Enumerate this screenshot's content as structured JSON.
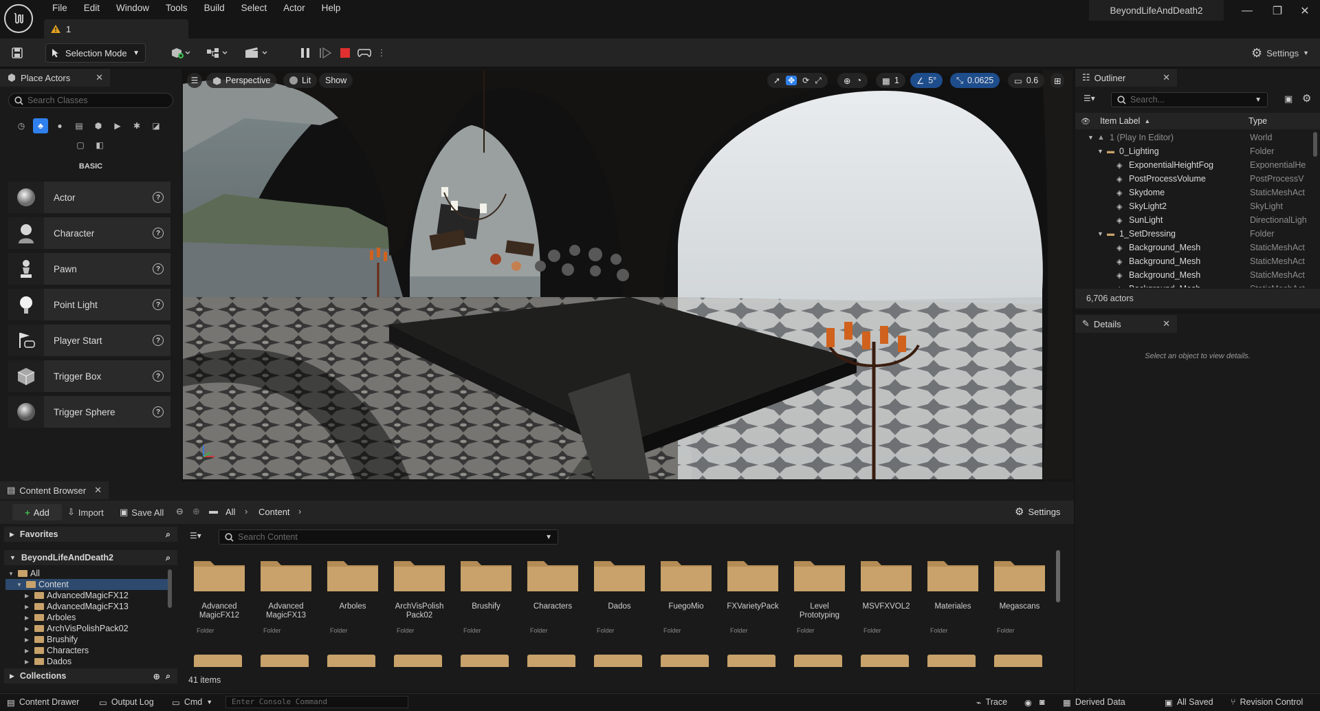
{
  "app": {
    "project_name": "BeyondLifeAndDeath2",
    "doc_tab_label": "1",
    "menu": [
      "File",
      "Edit",
      "Window",
      "Tools",
      "Build",
      "Select",
      "Actor",
      "Help"
    ]
  },
  "toolbar": {
    "selection_mode": "Selection Mode",
    "settings": "Settings"
  },
  "place_actors": {
    "title": "Place Actors",
    "search_placeholder": "Search Classes",
    "category": "BASIC",
    "items": [
      {
        "label": "Actor",
        "icon": "sphere-icon"
      },
      {
        "label": "Character",
        "icon": "character-icon"
      },
      {
        "label": "Pawn",
        "icon": "pawn-icon"
      },
      {
        "label": "Point Light",
        "icon": "bulb-icon"
      },
      {
        "label": "Player Start",
        "icon": "player-start-icon"
      },
      {
        "label": "Trigger Box",
        "icon": "box-icon"
      },
      {
        "label": "Trigger Sphere",
        "icon": "sphere-icon"
      }
    ]
  },
  "viewport": {
    "perspective": "Perspective",
    "lit": "Lit",
    "show": "Show",
    "grid_snap": "1",
    "rotation_snap": "5°",
    "scale_snap": "0.0625",
    "camera_speed": "0.6"
  },
  "outliner": {
    "title": "Outliner",
    "search_placeholder": "Search...",
    "col_label": "Item Label",
    "col_type": "Type",
    "rows": [
      {
        "label": "1 (Play In Editor)",
        "type": "World",
        "indent": 1,
        "kind": "world"
      },
      {
        "label": "0_Lighting",
        "type": "Folder",
        "indent": 2,
        "kind": "folder"
      },
      {
        "label": "ExponentialHeightFog",
        "type": "ExponentialHe",
        "indent": 3,
        "kind": "actor"
      },
      {
        "label": "PostProcessVolume",
        "type": "PostProcessV",
        "indent": 3,
        "kind": "actor"
      },
      {
        "label": "Skydome",
        "type": "StaticMeshAct",
        "indent": 3,
        "kind": "actor"
      },
      {
        "label": "SkyLight2",
        "type": "SkyLight",
        "indent": 3,
        "kind": "actor"
      },
      {
        "label": "SunLight",
        "type": "DirectionalLigh",
        "indent": 3,
        "kind": "actor"
      },
      {
        "label": "1_SetDressing",
        "type": "Folder",
        "indent": 2,
        "kind": "folder"
      },
      {
        "label": "Background_Mesh",
        "type": "StaticMeshAct",
        "indent": 3,
        "kind": "actor"
      },
      {
        "label": "Background_Mesh",
        "type": "StaticMeshAct",
        "indent": 3,
        "kind": "actor"
      },
      {
        "label": "Background_Mesh",
        "type": "StaticMeshAct",
        "indent": 3,
        "kind": "actor"
      },
      {
        "label": "Background_Mesh",
        "type": "StaticMeshAct",
        "indent": 3,
        "kind": "actor"
      }
    ],
    "actor_count": "6,706 actors"
  },
  "details": {
    "title": "Details",
    "empty_message": "Select an object to view details."
  },
  "content_browser": {
    "title": "Content Browser",
    "add": "Add",
    "import": "Import",
    "save_all": "Save All",
    "path": [
      "All",
      "Content"
    ],
    "settings": "Settings",
    "favorites": "Favorites",
    "project": "BeyondLifeAndDeath2",
    "collections": "Collections",
    "search_placeholder": "Search Content",
    "tree": [
      "All",
      "Content",
      "AdvancedMagicFX12",
      "AdvancedMagicFX13",
      "Arboles",
      "ArchVisPolishPack02",
      "Brushify",
      "Characters",
      "Dados"
    ],
    "folders": [
      {
        "name": "Advanced MagicFX12",
        "kind": "Folder"
      },
      {
        "name": "Advanced MagicFX13",
        "kind": "Folder"
      },
      {
        "name": "Arboles",
        "kind": "Folder"
      },
      {
        "name": "ArchVisPolish Pack02",
        "kind": "Folder"
      },
      {
        "name": "Brushify",
        "kind": "Folder"
      },
      {
        "name": "Characters",
        "kind": "Folder"
      },
      {
        "name": "Dados",
        "kind": "Folder"
      },
      {
        "name": "FuegoMio",
        "kind": "Folder"
      },
      {
        "name": "FXVarietyPack",
        "kind": "Folder"
      },
      {
        "name": "Level Prototyping",
        "kind": "Folder"
      },
      {
        "name": "MSVFXVOL2",
        "kind": "Folder"
      },
      {
        "name": "Materiales",
        "kind": "Folder"
      },
      {
        "name": "Megascans",
        "kind": "Folder"
      }
    ],
    "item_count": "41 items"
  },
  "statusbar": {
    "content_drawer": "Content Drawer",
    "output_log": "Output Log",
    "cmd": "Cmd",
    "console_placeholder": "Enter Console Command",
    "trace": "Trace",
    "derived_data": "Derived Data",
    "all_saved": "All Saved",
    "revision_control": "Revision Control"
  },
  "colors": {
    "accent": "#2f80ed",
    "folder": "#c8a26a",
    "stop_red": "#e03030",
    "tree_selected": "#2d4a6e"
  }
}
